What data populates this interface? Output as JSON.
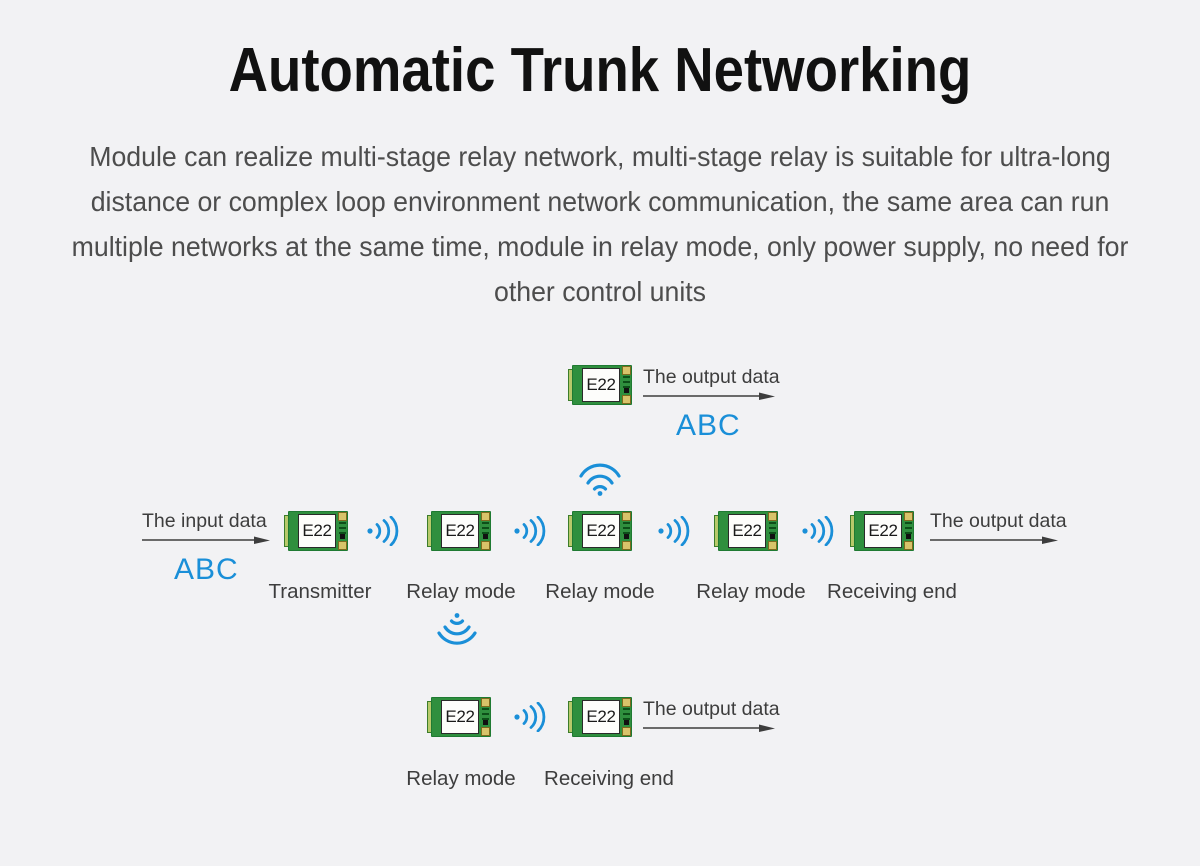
{
  "header": {
    "title": "Automatic Trunk Networking",
    "description": "Module can realize multi-stage relay network, multi-stage relay is suitable for ultra-long distance or complex loop environment network communication, the same area can run multiple networks at the same time, module in relay mode, only power supply, no need for other control units"
  },
  "colors": {
    "background": "#f2f2f4",
    "title": "#111111",
    "body_text": "#4d4d4d",
    "accent_blue": "#1a8fd8",
    "pcb_green": "#2f8f3e",
    "pad_gold": "#d8c36a"
  },
  "module_label": "E22",
  "labels": {
    "input_data": "The input data",
    "output_data": "The output data",
    "payload": "ABC",
    "transmitter": "Transmitter",
    "relay_mode": "Relay mode",
    "receiving_end": "Receiving end"
  },
  "diagram": {
    "top_branch": {
      "module": "E22",
      "data_label": "The output data",
      "payload": "ABC"
    },
    "main_chain": {
      "input_label": "The input data",
      "input_payload": "ABC",
      "output_label": "The output data",
      "nodes": [
        {
          "module": "E22",
          "role": "Transmitter"
        },
        {
          "module": "E22",
          "role": "Relay mode"
        },
        {
          "module": "E22",
          "role": "Relay mode"
        },
        {
          "module": "E22",
          "role": "Relay mode"
        },
        {
          "module": "E22",
          "role": "Receiving end"
        }
      ],
      "link_count": 4
    },
    "bottom_branch": {
      "data_label": "The output data",
      "nodes": [
        {
          "module": "E22",
          "role": "Relay mode"
        },
        {
          "module": "E22",
          "role": "Receiving end"
        }
      ]
    },
    "uplink_icon": "wifi-up-icon",
    "downlink_icon": "wifi-down-icon",
    "link_icon": "signal-waves-icon"
  }
}
